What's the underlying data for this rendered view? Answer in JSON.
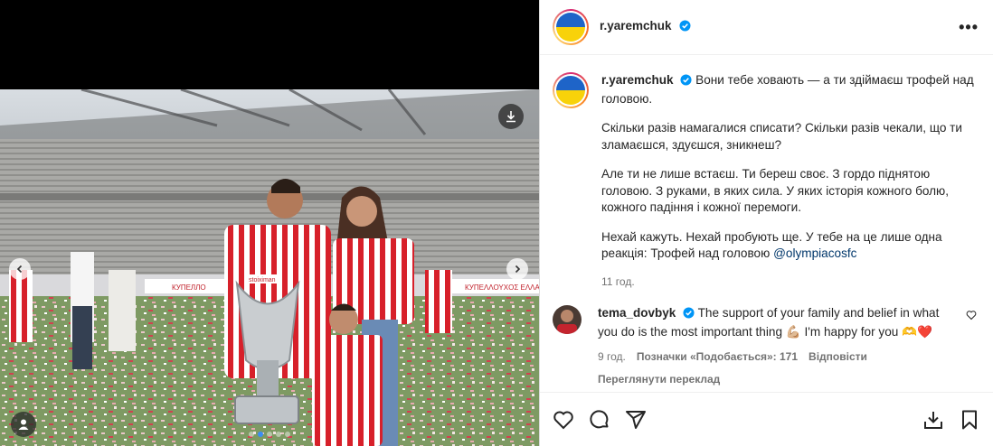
{
  "post": {
    "username": "r.yaremchuk",
    "caption": [
      "Вони тебе ховають — а ти здіймаєш трофей над головою.",
      "Скільки разів намагалися списати? Скільки разів чекали, що ти зламаєшся, здуєшся, зникнеш?",
      "Але ти не лише встаєш. Ти береш своє. З гордо піднятою головою. З руками, в яких сила. У яких історія кожного болю, кожного падіння і кожної перемоги.",
      "Нехай кажуть. Нехай пробують ще. У тебе на це лише одна реакція: Трофей над головою"
    ],
    "mention": "@olympiacosfc",
    "time": "11 год."
  },
  "comment": {
    "username": "tema_dovbyk",
    "text": "The support of your family and belief in what you do is the most important thing 💪🏼 I'm happy for you 🫶❤️",
    "time": "9 год.",
    "likes": "Позначки «Подобається»: 171",
    "reply": "Відповісти",
    "translate": "Переглянути переклад"
  },
  "photo": {
    "banner_text_left": "КУПЕЛЛО",
    "banner_text_right": "КУΠΕΛΛΟΥΧΟΣ ΕΛΛΑΔΟΣ",
    "shirt_text": "stoiximan"
  },
  "icons": {
    "verified": "verified-badge-icon",
    "more": "more-options-icon",
    "like": "heart-icon",
    "comment": "comment-icon",
    "share": "share-icon",
    "save": "bookmark-icon",
    "download": "download-icon"
  },
  "colors": {
    "verified": "#0095f6",
    "mention": "#00376b",
    "flag_blue": "#1e64c8",
    "flag_yellow": "#f8d20a"
  },
  "carousel": {
    "count": 5,
    "active": 1
  }
}
